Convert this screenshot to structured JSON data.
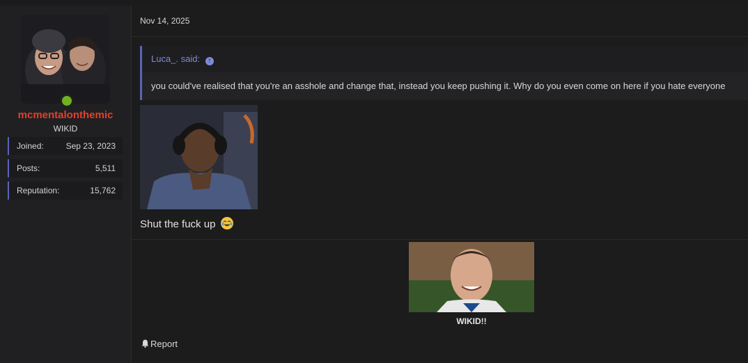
{
  "author": {
    "username": "mcmentalonthemic",
    "title": "WIKID",
    "username_color": "#e2412d",
    "online_color": "#6fb21e",
    "stats": [
      {
        "label": "Joined:",
        "value": "Sep 23, 2023"
      },
      {
        "label": "Posts:",
        "value": "5,511"
      },
      {
        "label": "Reputation:",
        "value": "15,762"
      }
    ]
  },
  "post": {
    "date": "Nov 14, 2025",
    "quote": {
      "author_said": "Luca_. said:",
      "icon": "arrow-up-circle-icon",
      "text": "you could've realised that you're an asshole and change that, instead you keep pushing it. Why do you even come on here if you hate everyone"
    },
    "reply_text": "Shut the fuck up",
    "reply_emoji": "crying-laughing-emoji",
    "signature": {
      "caption": "WIKID!!"
    },
    "actions": {
      "report_label": "Report",
      "report_icon": "bell-icon"
    }
  },
  "colors": {
    "accent": "#5a63b8",
    "link": "#7f8ad6",
    "background": "#1c1c1d"
  }
}
